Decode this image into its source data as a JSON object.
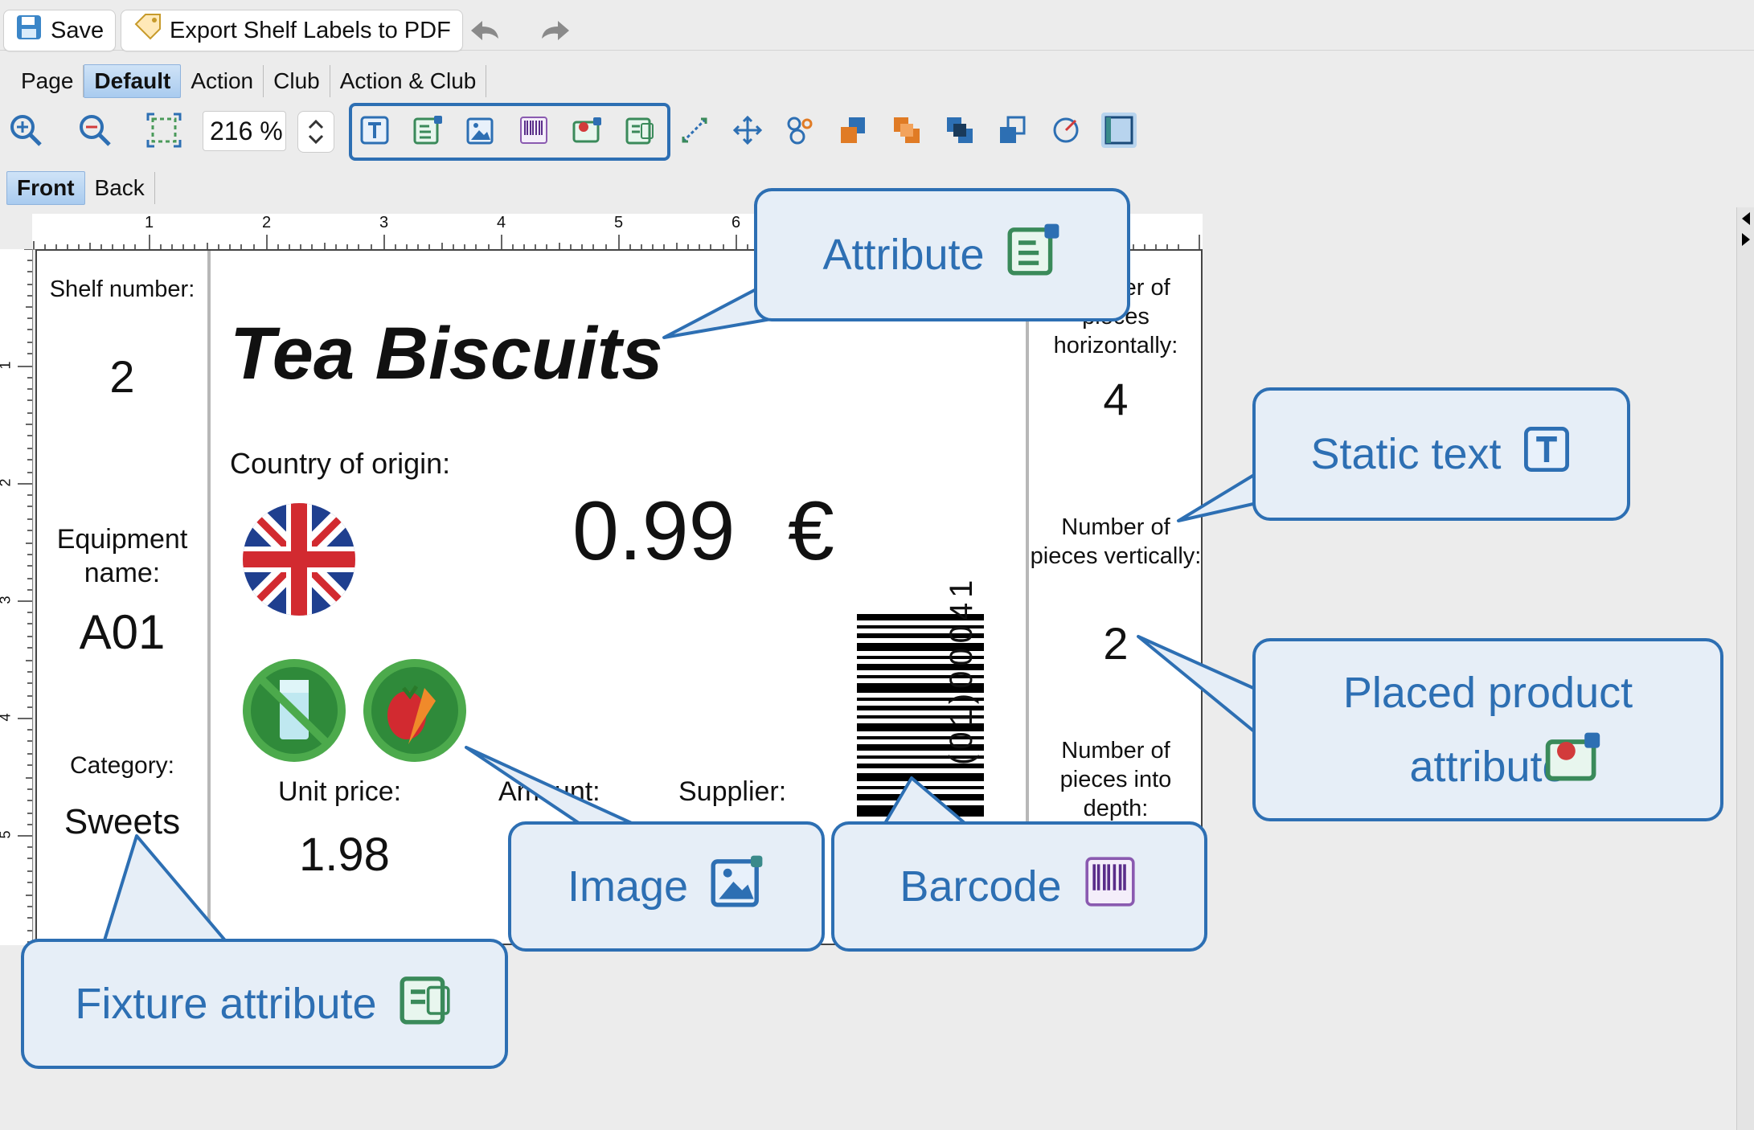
{
  "toolbar": {
    "save_label": "Save",
    "export_label": "Export Shelf Labels to PDF"
  },
  "tabs": [
    "Page",
    "Default",
    "Action",
    "Club",
    "Action & Club"
  ],
  "zoom": {
    "value": "216 %"
  },
  "sides": [
    "Front",
    "Back"
  ],
  "ruler": {
    "h": [
      "1",
      "2",
      "3",
      "4",
      "5",
      "6"
    ],
    "v": [
      "1",
      "2",
      "3",
      "4",
      "5"
    ]
  },
  "label": {
    "shelf_number_label": "Shelf number:",
    "shelf_number": "2",
    "equipment_label": "Equipment name:",
    "equipment": "A01",
    "category_label": "Category:",
    "category": "Sweets",
    "title": "Tea Biscuits",
    "country_label": "Country of origin:",
    "price": "0.99",
    "currency": "€",
    "unit_price_label": "Unit price:",
    "unit_price": "1.98",
    "amount_label": "Amount:",
    "supplier_label": "Supplier:",
    "barcode_digits": "(01)00041",
    "horiz_label_1": "Number of",
    "horiz_label_2": "pieces",
    "horiz_label_3": "horizontally:",
    "horiz_value": "4",
    "vert_label": "Number of pieces vertically:",
    "vert_value": "2",
    "depth_label": "Number of pieces into depth:"
  },
  "callouts": {
    "attribute": "Attribute",
    "static_text": "Static text",
    "placed_product": "Placed product attribute",
    "image": "Image",
    "barcode": "Barcode",
    "fixture": "Fixture attribute"
  },
  "colors": {
    "accent": "#2d6fb3",
    "callout_bg": "#e6eef7",
    "tab_active": "#a9cbef"
  }
}
